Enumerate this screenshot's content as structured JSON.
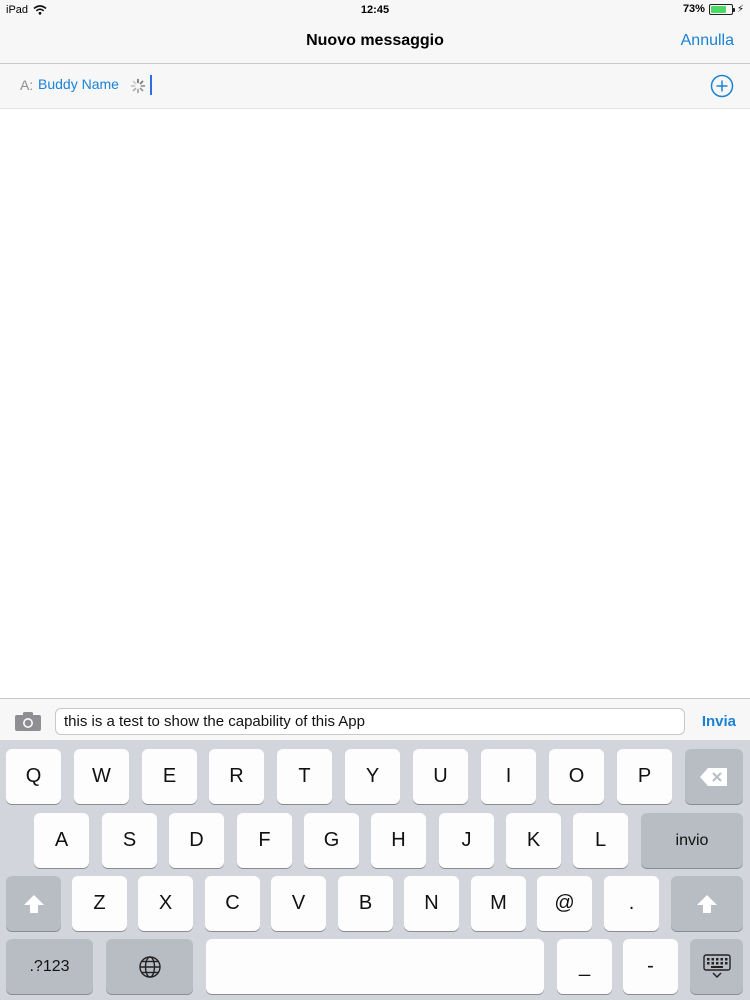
{
  "status_bar": {
    "device": "iPad",
    "time": "12:45",
    "battery_percent": "73%",
    "battery_level": 0.73
  },
  "nav": {
    "title": "Nuovo messaggio",
    "cancel_label": "Annulla"
  },
  "recipient": {
    "label": "A:",
    "name": "Buddy Name"
  },
  "compose": {
    "message_text": "this is a test to show the capability of this App",
    "send_label": "Invia"
  },
  "keyboard": {
    "row1": [
      "Q",
      "W",
      "E",
      "R",
      "T",
      "Y",
      "U",
      "I",
      "O",
      "P"
    ],
    "row2": [
      "A",
      "S",
      "D",
      "F",
      "G",
      "H",
      "J",
      "K",
      "L"
    ],
    "return_label": "invio",
    "row3": [
      "Z",
      "X",
      "C",
      "V",
      "B",
      "N",
      "M",
      "@",
      "."
    ],
    "numbers_label": ".?123",
    "underscore": "_",
    "dash": "-"
  },
  "colors": {
    "accent": "#1a82d6",
    "keyboard_bg": "#d2d5db",
    "battery": "#4cd964"
  }
}
